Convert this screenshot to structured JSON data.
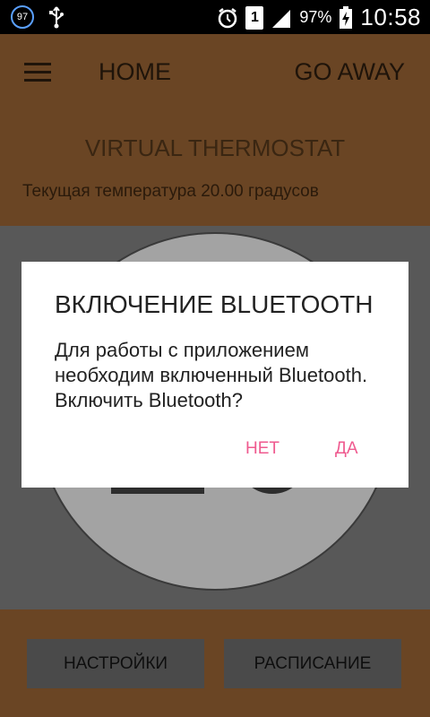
{
  "status_bar": {
    "notification_badge": "97",
    "usb_icon": "usb-icon",
    "alarm_icon": "alarm-icon",
    "sim_label": "1",
    "signal_icon": "signal-icon",
    "battery_percent": "97%",
    "battery_icon": "battery-charging-icon",
    "time": "10:58"
  },
  "app_bar": {
    "menu_icon": "menu-icon",
    "home_label": "HOME",
    "go_away_label": "GO AWAY",
    "title": "VIRTUAL THERMOSTAT",
    "current_temperature": "Текущая температура 20.00 градусов"
  },
  "bottom_bar": {
    "settings_label": "НАСТРОЙКИ",
    "schedule_label": "РАСПИСАНИЕ"
  },
  "dialog": {
    "title": "ВКЛЮЧЕНИЕ BLUETOOTH",
    "message": "Для работы с приложением необходим включенный Bluetooth. Включить Bluetooth?",
    "negative_label": "НЕТ",
    "positive_label": "ДА"
  },
  "colors": {
    "brand_brown": "#6a4524",
    "dialog_accent": "#ef5a8f",
    "dim_overlay": "#585858"
  }
}
